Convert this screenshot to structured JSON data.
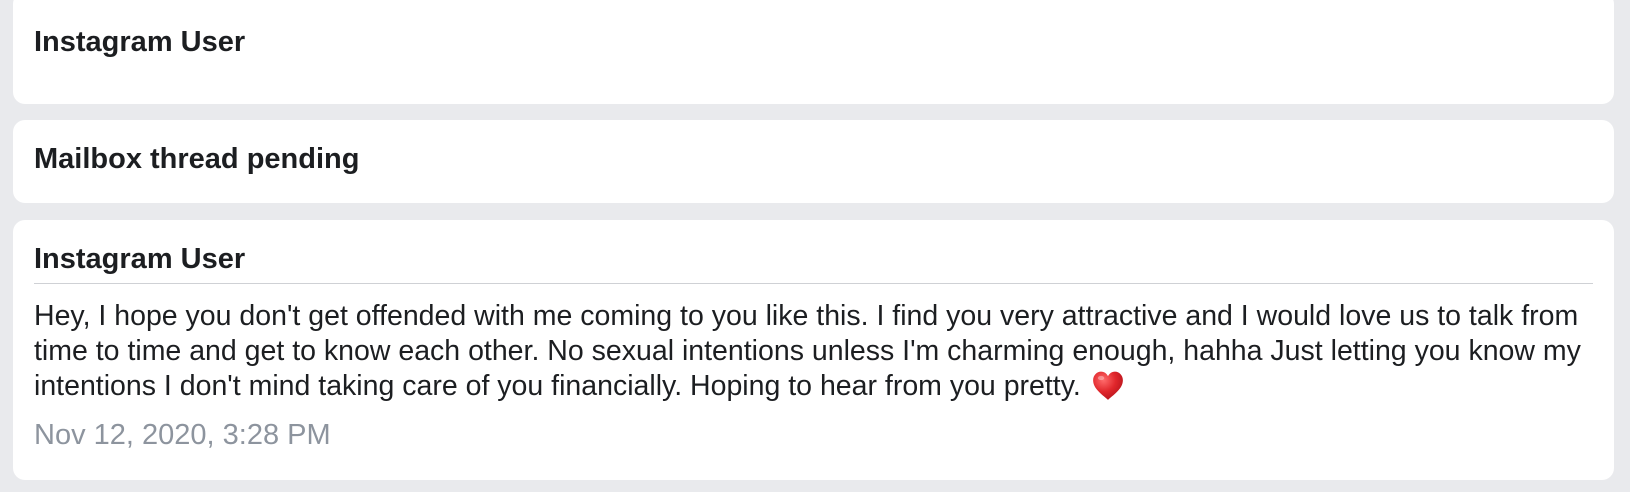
{
  "threads": [
    {
      "sender": "Instagram User"
    },
    {
      "sender": "Mailbox thread pending"
    },
    {
      "sender": "Instagram User",
      "message": "Hey, I hope you don't get offended with me coming to you like this. I find you very attractive and I would love us to talk from time to time and get to know each other. No sexual intentions unless I'm charming enough, hahha Just letting you know my intentions I don't mind taking care of you financially. Hoping to hear from you pretty.",
      "emoji": "red-heart-icon",
      "timestamp": "Nov 12, 2020, 3:28 PM"
    }
  ],
  "colors": {
    "page_background": "#e9eaed",
    "card_background": "#ffffff",
    "primary_text": "#1c1e21",
    "secondary_text": "#8d949e",
    "heart": "#e0262b"
  }
}
